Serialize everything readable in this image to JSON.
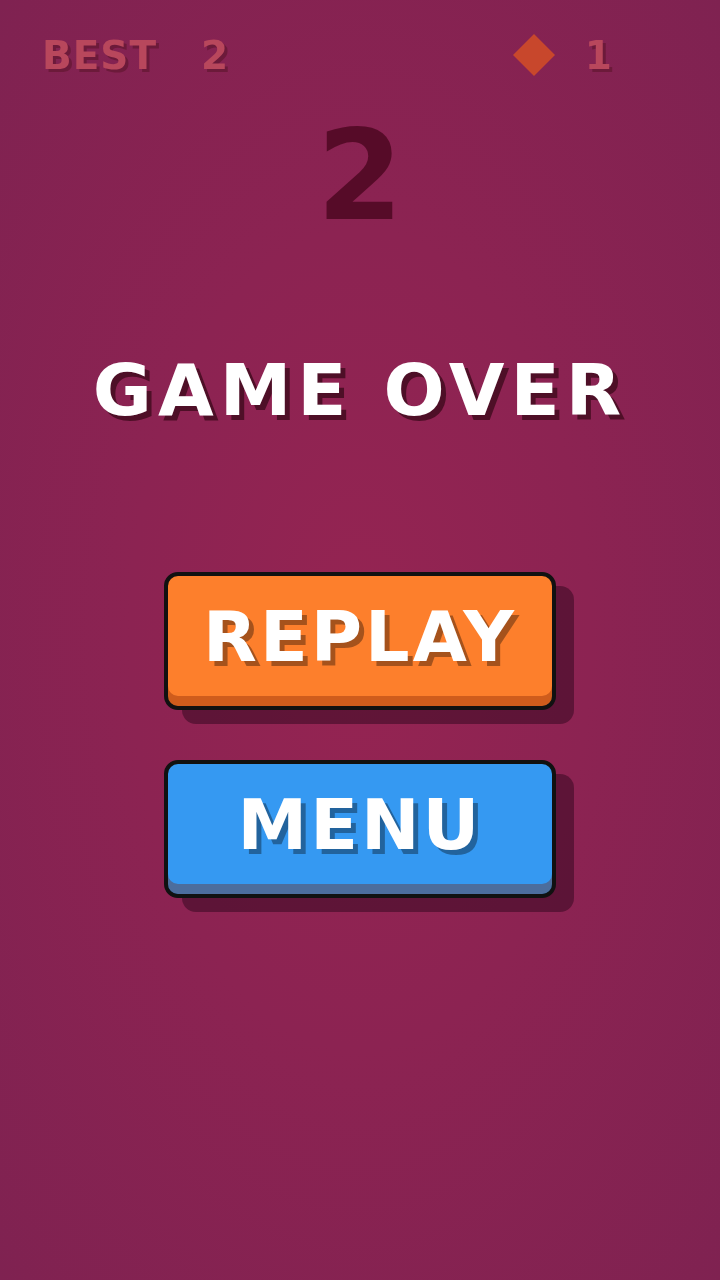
{
  "header": {
    "best_label": "BEST",
    "best_value": "2",
    "gem_count": "1"
  },
  "score": "2",
  "title": "GAME OVER",
  "buttons": [
    {
      "label": "REPLAY",
      "color": "#fd7f2c"
    },
    {
      "label": "MENU",
      "color": "#3599f2"
    }
  ]
}
